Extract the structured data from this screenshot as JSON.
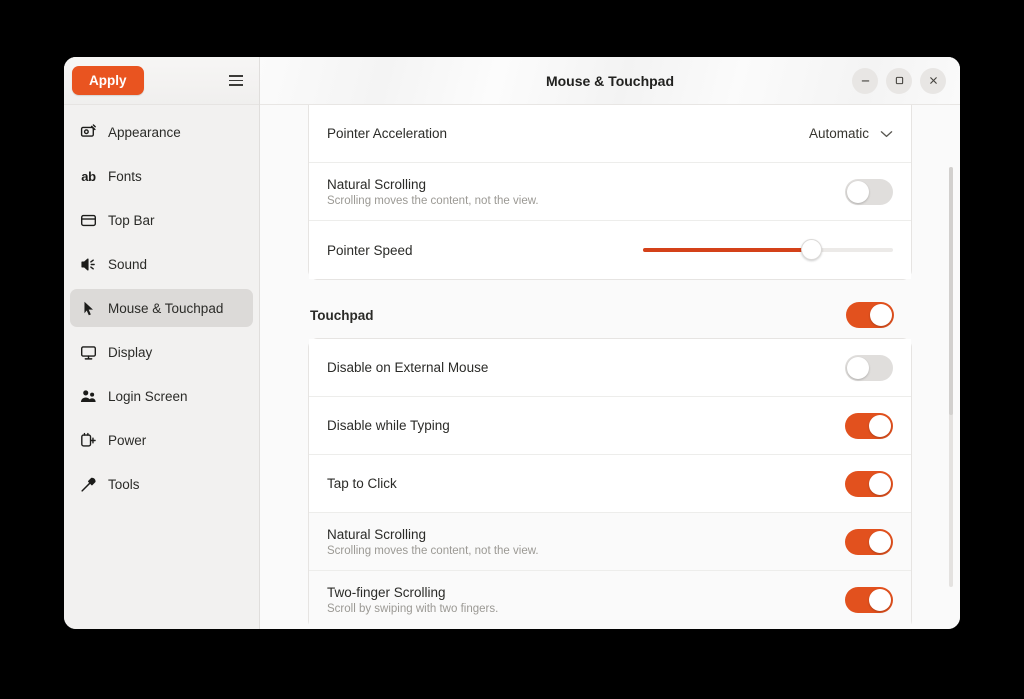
{
  "window": {
    "title": "Mouse & Touchpad",
    "controls": [
      {
        "name": "minimize",
        "glyph": "–"
      },
      {
        "name": "maximize",
        "glyph": "□"
      },
      {
        "name": "close",
        "glyph": "✕"
      }
    ]
  },
  "sidebar": {
    "apply_label": "Apply",
    "menu_label": "",
    "items": [
      {
        "label": "Appearance",
        "icon": "appearance-icon",
        "active": false
      },
      {
        "label": "Fonts",
        "icon": "fonts-icon",
        "active": false
      },
      {
        "label": "Top Bar",
        "icon": "top-bar-icon",
        "active": false
      },
      {
        "label": "Sound",
        "icon": "sound-icon",
        "active": false
      },
      {
        "label": "Mouse & Touchpad",
        "icon": "mouse-pointer-icon",
        "active": true
      },
      {
        "label": "Display",
        "icon": "display-icon",
        "active": false
      },
      {
        "label": "Login Screen",
        "icon": "login-screen-icon",
        "active": false
      },
      {
        "label": "Power",
        "icon": "power-icon",
        "active": false
      },
      {
        "label": "Tools",
        "icon": "tools-icon",
        "active": false
      }
    ]
  },
  "mouse_card": {
    "pointer_acceleration": {
      "label": "Pointer Acceleration",
      "value": "Automatic"
    },
    "natural_scrolling": {
      "label": "Natural Scrolling",
      "subtitle": "Scrolling moves the content, not the view.",
      "state": "off"
    },
    "pointer_speed": {
      "label": "Pointer Speed",
      "value_percent": 67
    }
  },
  "touchpad_section": {
    "heading": "Touchpad",
    "master_toggle_state": "on",
    "rows": [
      {
        "label": "Disable on External Mouse",
        "subtitle": "",
        "state": "off",
        "shaded": false
      },
      {
        "label": "Disable while Typing",
        "subtitle": "",
        "state": "on",
        "shaded": false
      },
      {
        "label": "Tap to Click",
        "subtitle": "",
        "state": "on",
        "shaded": false
      },
      {
        "label": "Natural Scrolling",
        "subtitle": "Scrolling moves the content, not the view.",
        "state": "on",
        "shaded": true
      },
      {
        "label": "Two-finger Scrolling",
        "subtitle": "Scroll by swiping with two fingers.",
        "state": "on",
        "shaded": true
      }
    ]
  },
  "colors": {
    "accent_orange": "#e2511e",
    "apply_orange": "#e95420",
    "highlight_border": "#4f4fa8",
    "sidebar_bg": "#f2f1f0",
    "card_bg": "#ffffff"
  }
}
